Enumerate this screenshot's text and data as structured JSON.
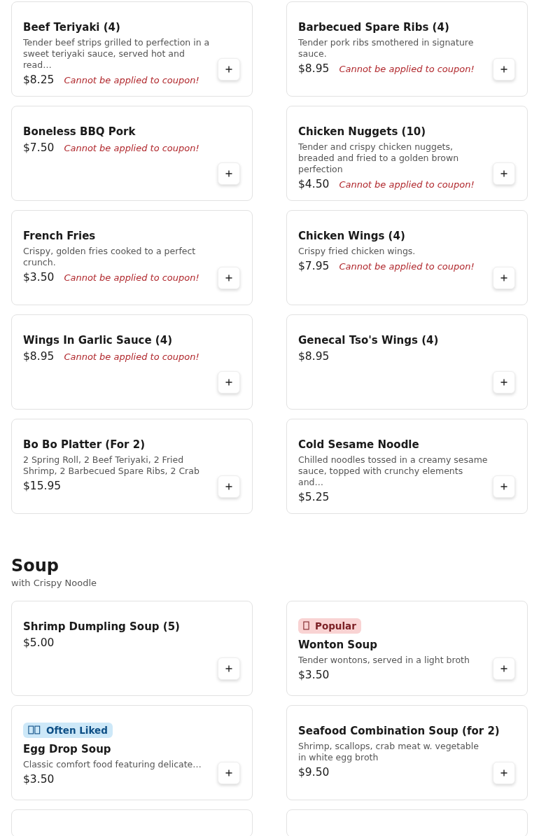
{
  "sections": [
    {
      "items": [
        {
          "name": "Beef Teriyaki (4)",
          "description": "Tender beef strips grilled to perfection in a sweet teriyaki sauce, served hot and read…",
          "price": "$8.25",
          "note": "Cannot be applied to coupon!"
        },
        {
          "name": "Barbecued Spare Ribs (4)",
          "description": "Tender pork ribs smothered in signature sauce.",
          "price": "$8.95",
          "note": "Cannot be applied to coupon!"
        },
        {
          "name": "Boneless BBQ Pork",
          "price": "$7.50",
          "note": "Cannot be applied to coupon!"
        },
        {
          "name": "Chicken Nuggets (10)",
          "description": "Tender and crispy chicken nuggets, breaded and fried to a golden brown perfection",
          "price": "$4.50",
          "note": "Cannot be applied to coupon!"
        },
        {
          "name": "French Fries",
          "description": "Crispy, golden fries cooked to a perfect crunch.",
          "price": "$3.50",
          "note": "Cannot be applied to coupon!"
        },
        {
          "name": "Chicken Wings (4)",
          "description": "Crispy fried chicken wings.",
          "price": "$7.95",
          "note": "Cannot be applied to coupon!"
        },
        {
          "name": "Wings In Garlic Sauce (4)",
          "price": "$8.95",
          "note": "Cannot be applied to coupon!"
        },
        {
          "name": "Genecal Tso's Wings (4)",
          "price": "$8.95"
        },
        {
          "name": "Bo Bo Platter (For 2)",
          "description": "2 Spring Roll, 2 Beef Teriyaki, 2 Fried Shrimp, 2 Barbecued Spare Ribs, 2 Crab",
          "price": "$15.95"
        },
        {
          "name": "Cold Sesame Noodle",
          "description": "Chilled noodles tossed in a creamy sesame sauce, topped with crunchy elements and…",
          "price": "$5.25"
        }
      ]
    },
    {
      "title": "Soup",
      "subtitle": "with Crispy Noodle",
      "items": [
        {
          "name": "Shrimp Dumpling Soup (5)",
          "price": "$5.00"
        },
        {
          "badge": {
            "kind": "popular",
            "label": "Popular"
          },
          "name": "Wonton Soup",
          "description": "Tender wontons, served in a light broth",
          "price": "$3.50"
        },
        {
          "badge": {
            "kind": "liked",
            "label": "Often Liked"
          },
          "name": "Egg Drop Soup",
          "description": "Classic comfort food featuring delicate…",
          "price": "$3.50"
        },
        {
          "name": "Seafood Combination Soup (for 2)",
          "description": "Shrimp, scallops, crab meat w. vegetable in white egg broth",
          "price": "$9.50"
        },
        {
          "kind": "cut-off"
        },
        {
          "kind": "cut-off"
        }
      ]
    }
  ]
}
